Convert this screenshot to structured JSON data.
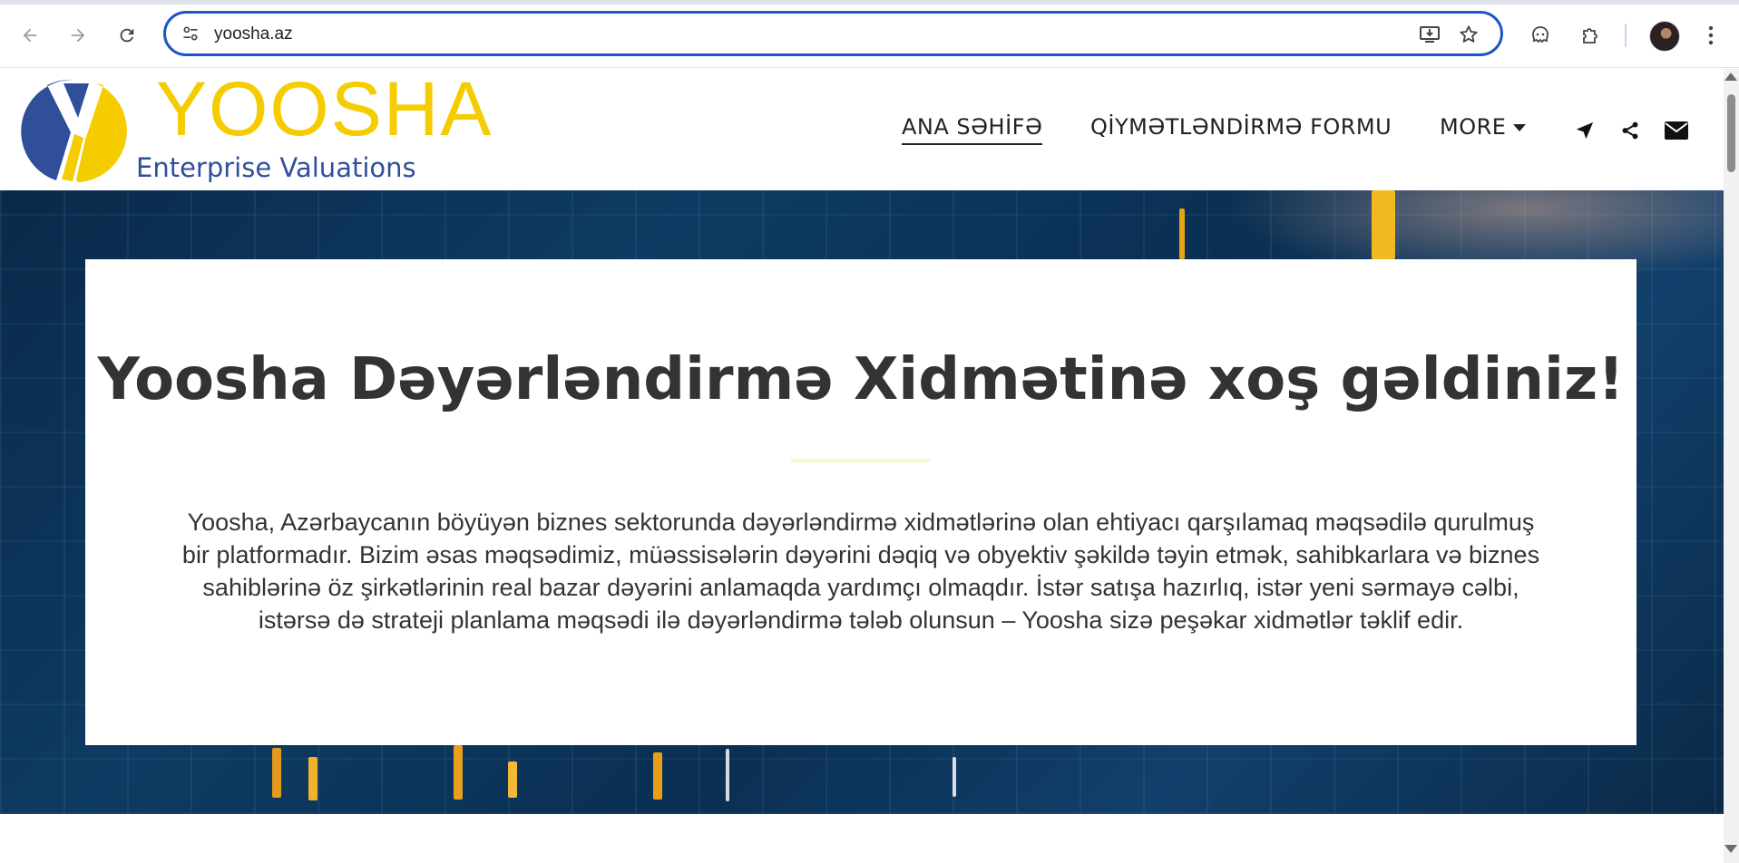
{
  "browser": {
    "url": "yoosha.az",
    "nav": {
      "back_icon": "back-arrow-icon",
      "forward_icon": "forward-arrow-icon",
      "reload_icon": "reload-icon"
    },
    "omnibox_icons": [
      "site-info-icon",
      "install-app-icon",
      "bookmark-star-icon"
    ],
    "toolbar_icons": [
      "extension-ghost-icon",
      "extensions-puzzle-icon",
      "profile-avatar",
      "kebab-menu-icon"
    ],
    "accent_color": "#1a56c5"
  },
  "site": {
    "logo": {
      "name": "YOOSHA",
      "tagline": "Enterprise Valuations",
      "colors": {
        "yellow": "#f5cc00",
        "blue": "#2f4f9b"
      }
    },
    "menu": {
      "items": [
        {
          "label": "ANA SƏHİFƏ",
          "active": true
        },
        {
          "label": "QİYMƏTLƏNDİRMƏ FORMU",
          "active": false
        },
        {
          "label": "MORE",
          "active": false,
          "dropdown": true
        }
      ],
      "icons": [
        "location-arrow-icon",
        "share-icon",
        "envelope-icon"
      ]
    },
    "hero": {
      "title": "Yoosha Dəyərləndirmə Xidmətinə xoş gəldiniz!",
      "body": "Yoosha, Azərbaycanın böyüyən biznes sektorunda dəyərləndirmə xidmətlərinə olan ehtiyacı qarşılamaq məqsədilə qurulmuş bir platformadır. Bizim əsas məqsədimiz, müəssisələrin dəyərini dəqiq və obyektiv şəkildə təyin etmək, sahibkarlara və biznes sahiblərinə öz şirkətlərinin real bazar dəyərini anlamaqda yardımçı olmaqdır. İstər satışa hazırlıq, istər yeni sərmayə cəlbi, istərsə də strateji planlama məqsədi ilə dəyərləndirmə tələb olunsun – Yoosha sizə peşəkar xidmətlər təklif edir.",
      "background": "#0e3b63"
    }
  }
}
